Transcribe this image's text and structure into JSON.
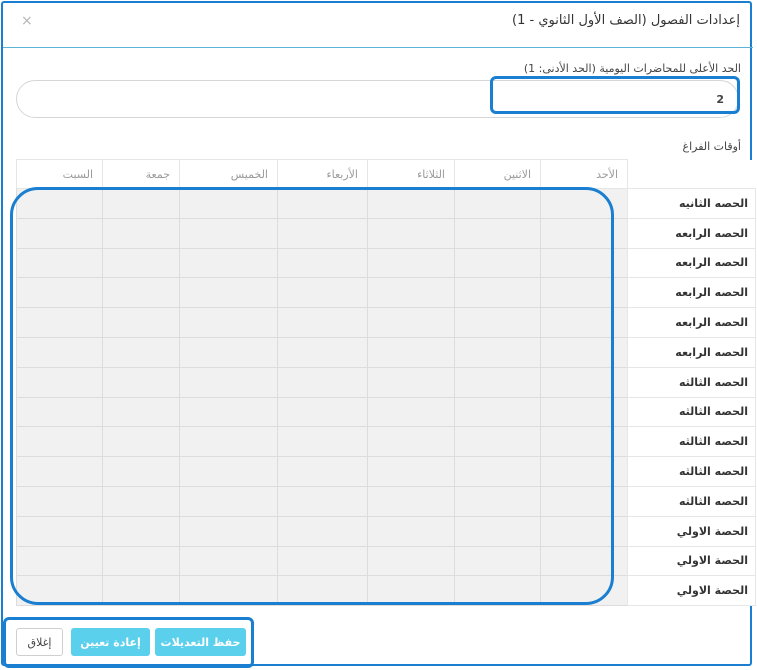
{
  "dialog": {
    "title": "إعدادات الفصول (الصف الأول الثانوي - 1)",
    "close_glyph": "×"
  },
  "max_lectures": {
    "label": "الحد الأعلى للمحاضرات اليومية (الحد الأدنى: 1)",
    "value": "2"
  },
  "free_times": {
    "label": "أوقات الفراغ",
    "days": [
      "الأحد",
      "الاثنين",
      "الثلاثاء",
      "الأربعاء",
      "الخميس",
      "جمعة",
      "السبت"
    ],
    "periods": [
      "الحصه الثانيه",
      "الحصه الرابعه",
      "الحصه الرابعه",
      "الحصه الرابعه",
      "الحصه الرابعه",
      "الحصه الرابعه",
      "الحصه الثالثه",
      "الحصه الثالثه",
      "الحصه الثالثه",
      "الحصه الثالثه",
      "الحصه الثالثه",
      "الحصة الاولي",
      "الحصة الاولي",
      "الحصة الاولي"
    ]
  },
  "footer": {
    "save_label": "حفظ التعديلات",
    "reset_label": "إعادة تعيين",
    "close_label": "إغلاق"
  },
  "colors": {
    "accent": "#1a7fd0",
    "button": "#5bd0ec",
    "cell": "#f1f1f1"
  }
}
